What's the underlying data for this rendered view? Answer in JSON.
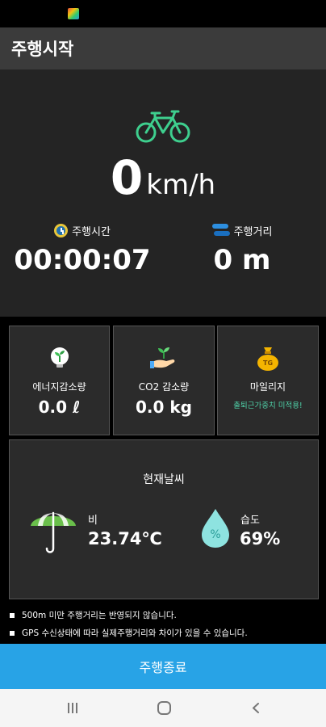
{
  "app": {
    "title": "주행시작"
  },
  "speed": {
    "value": "0",
    "unit": "km/h"
  },
  "metrics": {
    "time_label": "주행시간",
    "time_value": "00:00:07",
    "distance_label": "주행거리",
    "distance_value": "0 m"
  },
  "cards": {
    "energy_label": "에너지감소량",
    "energy_value": "0.0 ℓ",
    "co2_label": "CO2 감소량",
    "co2_value": "0.0 kg",
    "mileage_label": "마일리지",
    "mileage_note": "출퇴근가중치 미적용!",
    "mileage_badge": "TG"
  },
  "weather": {
    "title": "현재날씨",
    "condition_label": "비",
    "temperature": "23.74℃",
    "humidity_label": "습도",
    "humidity_value": "69%",
    "humidity_symbol": "%"
  },
  "notices": [
    "500m 미만 주행거리는 반영되지 않습니다.",
    "GPS 수신상태에 따라 실제주행거리와 차이가 있을 수 있습니다."
  ],
  "actions": {
    "end_label": "주행종료"
  },
  "icons": {
    "bike": "bicycle-icon",
    "clock": "clock-icon",
    "distance": "distance-icon",
    "energy": "lightbulb-plant-icon",
    "co2": "hand-sprout-icon",
    "mileage": "money-bag-icon",
    "weather": "umbrella-icon",
    "humidity": "water-drop-icon"
  },
  "colors": {
    "accent": "#28a3e6",
    "bike": "#3ecf8e",
    "note": "#4fd1a8"
  }
}
